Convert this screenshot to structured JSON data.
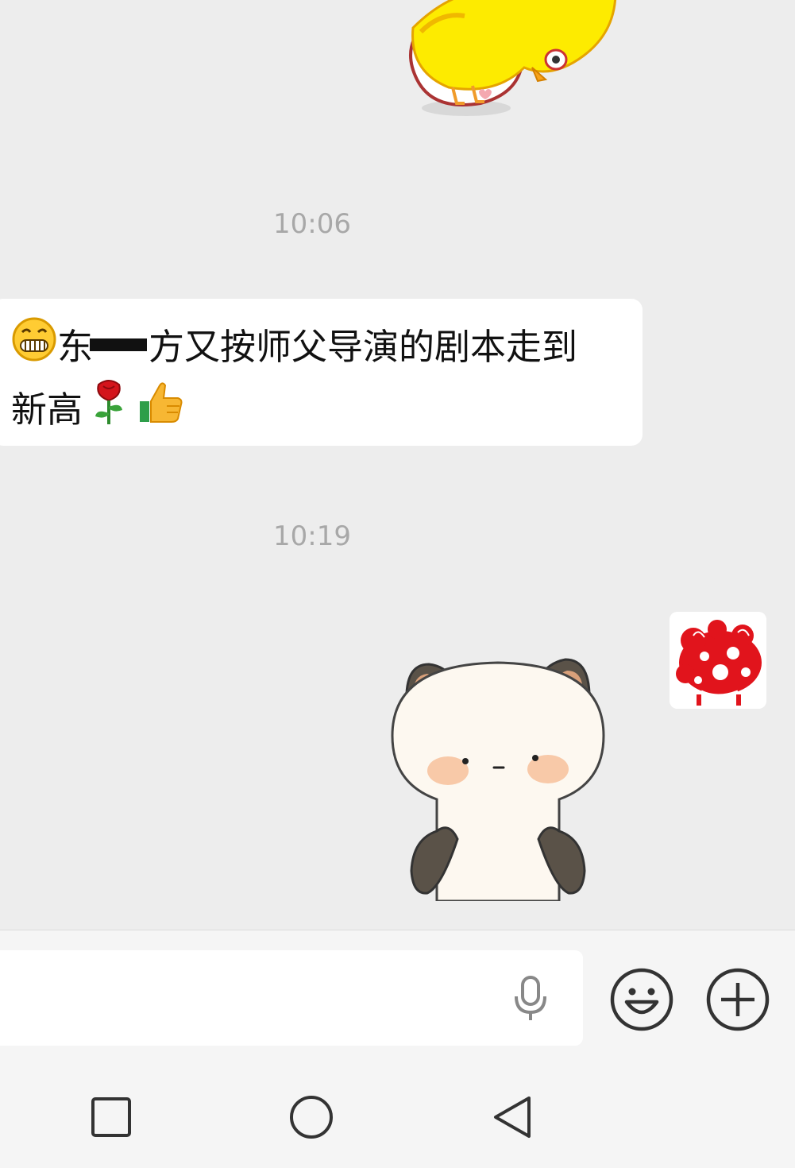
{
  "chat": {
    "timestamps": [
      "10:06",
      "10:19"
    ],
    "message": {
      "line1_prefix": "东",
      "line1_text": "方又按师父导演的剧本走到",
      "line2_text": "新高",
      "emojis": [
        "grin-emoji",
        "rose-emoji",
        "thumbs-up-emoji"
      ]
    },
    "stickers": [
      "yellow-duck-sticker",
      "panda-sticker"
    ],
    "avatar": "red-papercut-avatar"
  },
  "input_bar": {
    "placeholder": "",
    "icons": [
      "microphone-icon",
      "emoji-face-icon",
      "plus-icon"
    ]
  },
  "nav": {
    "icons": [
      "recent-apps-icon",
      "home-icon",
      "back-icon"
    ]
  },
  "colors": {
    "background": "#ededed",
    "bubble": "#ffffff",
    "timestamp": "#a8a8a8",
    "icon": "#333333"
  }
}
